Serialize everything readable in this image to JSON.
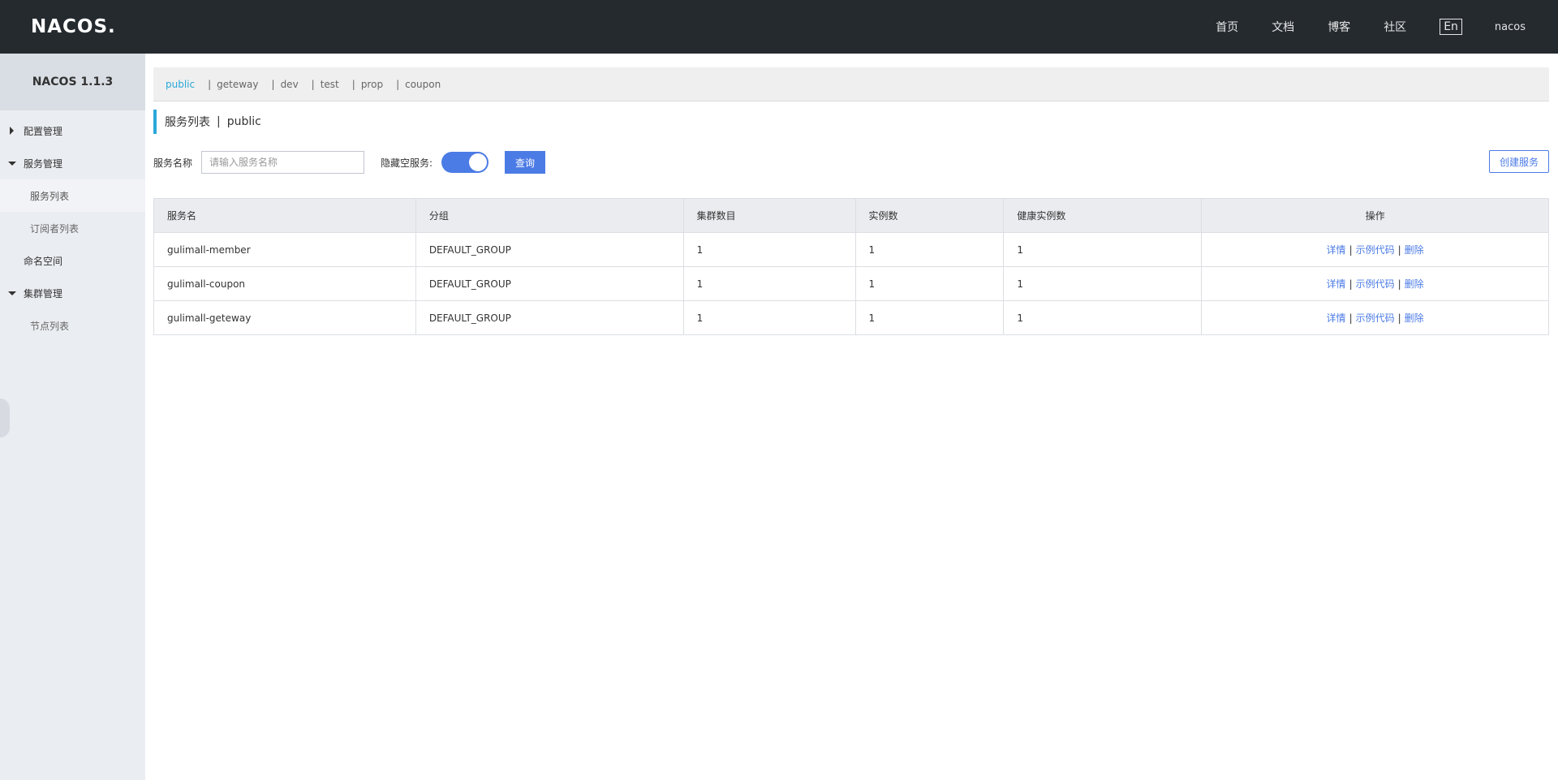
{
  "header": {
    "logo": "NACOS.",
    "nav": [
      "首页",
      "文档",
      "博客",
      "社区"
    ],
    "lang": "En",
    "user": "nacos"
  },
  "sidebar": {
    "title": "NACOS 1.1.3",
    "items": [
      {
        "label": "配置管理"
      },
      {
        "label": "服务管理"
      },
      {
        "label": "服务列表"
      },
      {
        "label": "订阅者列表"
      },
      {
        "label": "命名空间"
      },
      {
        "label": "集群管理"
      },
      {
        "label": "节点列表"
      }
    ]
  },
  "namespaces": [
    "public",
    "geteway",
    "dev",
    "test",
    "prop",
    "coupon"
  ],
  "page": {
    "title": "服务列表",
    "separator": "|",
    "namespace": "public"
  },
  "filters": {
    "service_name_label": "服务名称",
    "search_placeholder": "请输入服务名称",
    "hide_empty_label": "隐藏空服务:",
    "hide_empty_on": true,
    "query_label": "查询",
    "create_label": "创建服务"
  },
  "table": {
    "headers": [
      "服务名",
      "分组",
      "集群数目",
      "实例数",
      "健康实例数",
      "操作"
    ],
    "rows": [
      [
        "gulimall-member",
        "DEFAULT_GROUP",
        "1",
        "1",
        "1"
      ],
      [
        "gulimall-coupon",
        "DEFAULT_GROUP",
        "1",
        "1",
        "1"
      ],
      [
        "gulimall-geteway",
        "DEFAULT_GROUP",
        "1",
        "1",
        "1"
      ]
    ],
    "actions": [
      "详情",
      "示例代码",
      "删除"
    ],
    "action_sep": "|"
  },
  "colors": {
    "accent": "#2ba8d9",
    "primary": "#4b7be5",
    "topbar": "#252a2f",
    "sidebar": "#eaedf1"
  }
}
